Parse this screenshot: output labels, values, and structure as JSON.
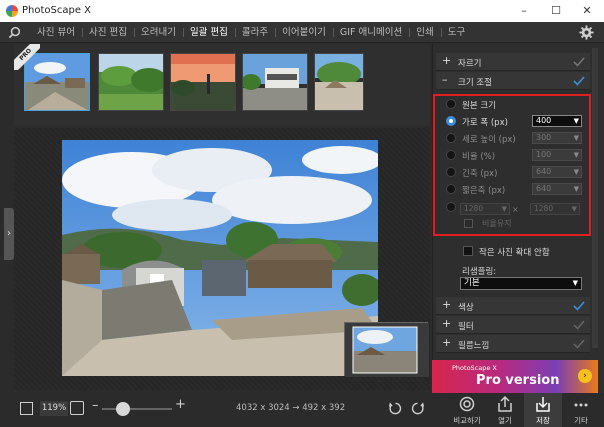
{
  "window": {
    "title": "PhotoScape X",
    "minimize": "–",
    "maximize": "☐",
    "close": "✕"
  },
  "menu": {
    "items": [
      {
        "label": "사진 뷰어"
      },
      {
        "label": "사진 편집"
      },
      {
        "label": "오려내기"
      },
      {
        "label": "일괄 편집",
        "active": true
      },
      {
        "label": "콜라주"
      },
      {
        "label": "이어붙이기"
      },
      {
        "label": "GIF 애니메이션"
      },
      {
        "label": "인쇄"
      },
      {
        "label": "도구"
      }
    ]
  },
  "thumbnails": {
    "badge": "PRO",
    "count": 5
  },
  "canvas": {
    "zoom": "119%",
    "dimensions": "4032 x 3024 → 492 x 392"
  },
  "panel": {
    "crop": {
      "label": "자르기",
      "enabled": false
    },
    "resize": {
      "label": "크기 조절",
      "enabled": true,
      "options": [
        {
          "label": "원본 크기",
          "selected": false
        },
        {
          "label": "가로 폭 (px)",
          "selected": true,
          "value": "400"
        },
        {
          "label": "세로 높이 (px)",
          "selected": false,
          "value": "300"
        },
        {
          "label": "비율 (%)",
          "selected": false,
          "value": "100"
        },
        {
          "label": "긴축 (px)",
          "selected": false,
          "value": "640"
        },
        {
          "label": "짧은축 (px)",
          "selected": false,
          "value": "640"
        }
      ],
      "ratio_left": "1280",
      "ratio_right": "1280",
      "swap_symbol": "×",
      "keep_ratio_label": "비율유지",
      "no_enlarge_label": "작은 사진 확대 안함",
      "resampling_label": "리샘플링:",
      "resampling_value": "기본"
    },
    "sections": [
      {
        "label": "색상",
        "enabled": true
      },
      {
        "label": "필터",
        "enabled": false
      },
      {
        "label": "필름느낌",
        "enabled": false
      }
    ],
    "promo": {
      "small": "PhotoScape X",
      "big": "Pro version"
    },
    "actions": [
      {
        "label": "비교하기",
        "icon": "compare-icon"
      },
      {
        "label": "열기",
        "icon": "open-icon"
      },
      {
        "label": "저장",
        "icon": "save-icon"
      },
      {
        "label": "기타",
        "icon": "more-icon"
      }
    ]
  },
  "colors": {
    "accent": "#3a8ee0",
    "highlight_box": "#e02020",
    "panel": "#2e2e2e"
  }
}
